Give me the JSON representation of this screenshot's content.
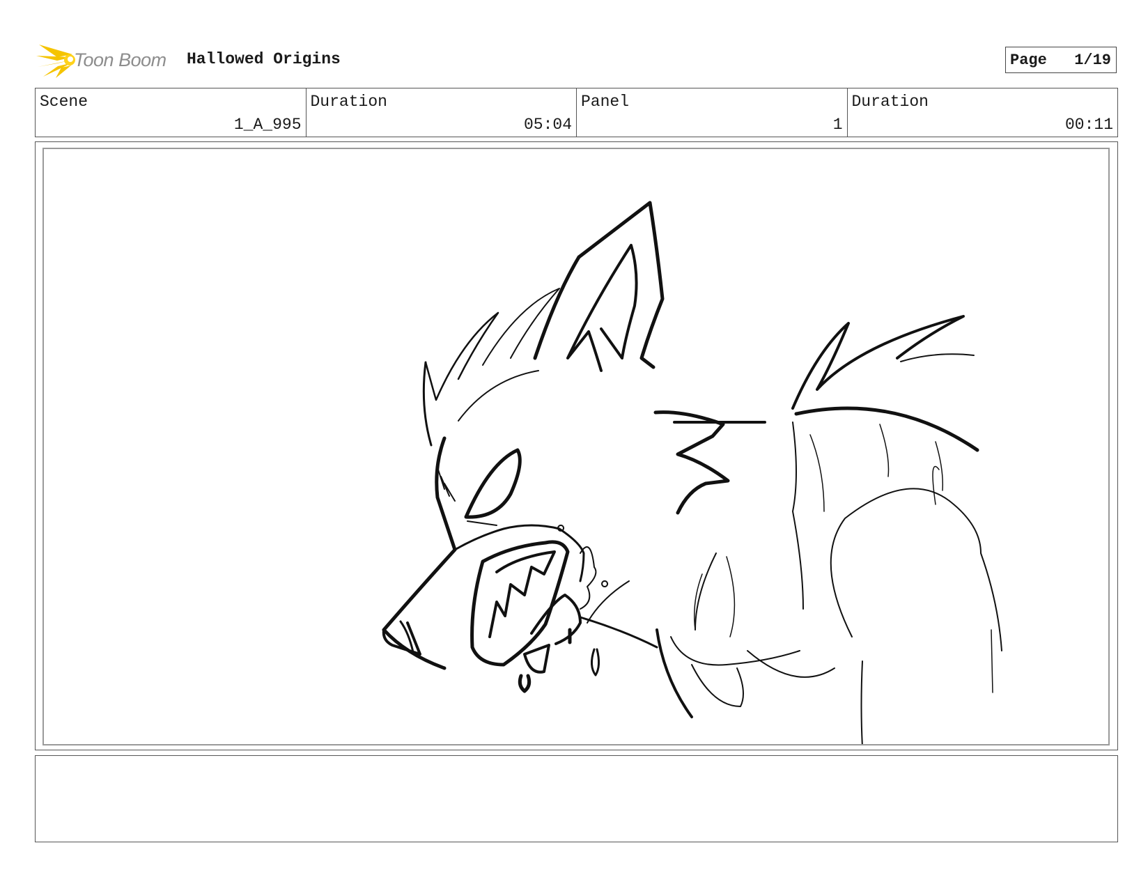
{
  "header": {
    "brand_name": "Toon Boom",
    "brand_icon": "toon-boom-burst-icon",
    "project_title": "Hallowed Origins",
    "page_label": "Page",
    "page_number": "1/19"
  },
  "info": {
    "scene": {
      "label": "Scene",
      "value": "1_A_995"
    },
    "scene_duration": {
      "label": "Duration",
      "value": "05:04"
    },
    "panel": {
      "label": "Panel",
      "value": "1"
    },
    "panel_duration": {
      "label": "Duration",
      "value": "00:11"
    }
  },
  "panel": {
    "image_subject": "werewolf-sketch"
  },
  "colors": {
    "brand_yellow": "#f5c400",
    "brand_text": "#8d8d8d",
    "border": "#555555",
    "ink": "#111111"
  }
}
